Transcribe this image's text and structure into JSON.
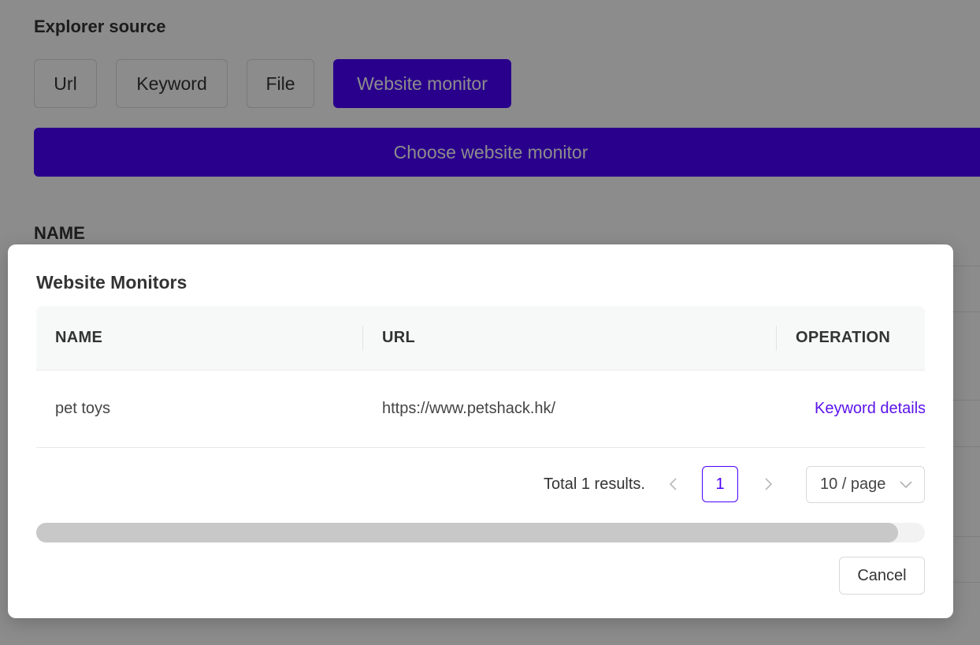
{
  "background": {
    "section_title": "Explorer source",
    "source_buttons": [
      {
        "label": "Url",
        "active": false
      },
      {
        "label": "Keyword",
        "active": false
      },
      {
        "label": "File",
        "active": false
      },
      {
        "label": "Website monitor",
        "active": true
      }
    ],
    "choose_button": "Choose website monitor",
    "table_header_name": "NAME"
  },
  "colors": {
    "accent": "#4b00ff",
    "link": "#5b14ea",
    "overlay": "rgba(0,0,0,0.45)"
  },
  "modal": {
    "title": "Website Monitors",
    "columns": [
      "NAME",
      "URL",
      "OPERATION"
    ],
    "rows": [
      {
        "name": "pet toys",
        "url": "https://www.petshack.hk/",
        "operation": "Keyword details"
      }
    ],
    "pagination": {
      "total_text": "Total 1 results.",
      "current_page": "1",
      "page_size": "10 / page",
      "prev_icon": "chevron-left-icon",
      "next_icon": "chevron-right-icon",
      "dropdown_icon": "chevron-down-icon"
    },
    "scrollbar": {
      "visible_fraction": 0.97
    },
    "cancel_label": "Cancel"
  }
}
